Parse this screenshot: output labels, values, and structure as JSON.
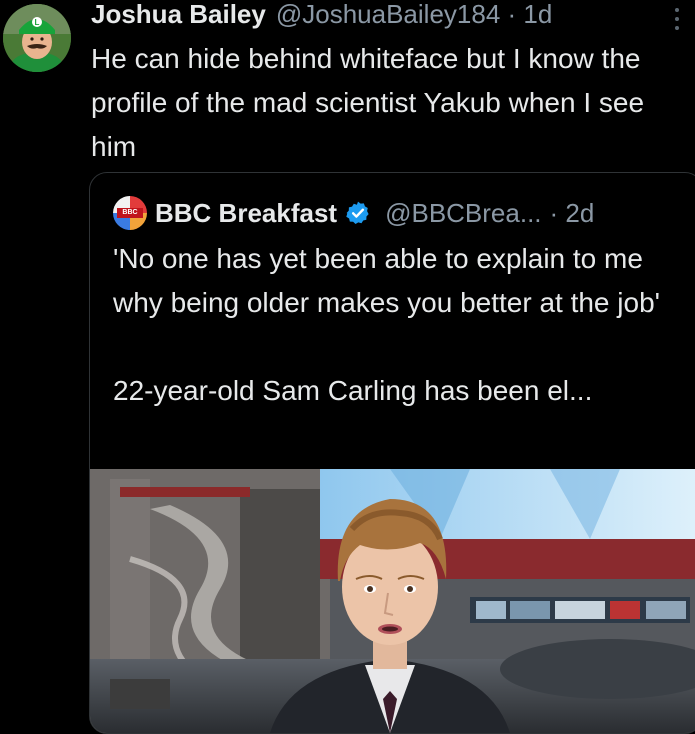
{
  "tweet": {
    "display_name": "Joshua Bailey",
    "handle_time": "@JoshuaBailey184 · 1d",
    "text": "He can hide behind whiteface but I know the profile of the mad scientist Yakub when I see him"
  },
  "quote": {
    "display_name": "BBC Breakfast",
    "handle": "@BBCBrea...",
    "time": "· 2d",
    "avatar_text": "BBC",
    "text": "'No one has yet been able to explain to me why being older makes you better at the job'\n\n22-year-old Sam Carling has been el..."
  },
  "colors": {
    "background": "#000000",
    "text": "#e7e9ea",
    "secondary_text": "#8b98a5",
    "verified": "#1d9bf0",
    "border": "#2f3336"
  },
  "icons": {
    "more": "more-icon",
    "verified": "verified-badge-icon"
  }
}
